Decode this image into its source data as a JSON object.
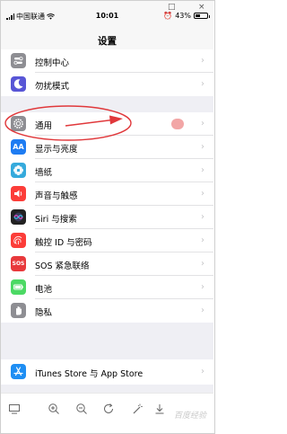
{
  "status": {
    "carrier": "中国联通",
    "time": "10:01",
    "battery": "43%",
    "battery_level": 0.43
  },
  "window_controls": [
    "□",
    "×"
  ],
  "nav": {
    "title": "设置"
  },
  "groups": [
    {
      "items": [
        {
          "label": "控制中心",
          "icon": "control-center-icon",
          "color": "#8e8e93"
        },
        {
          "label": "勿扰模式",
          "icon": "moon-icon",
          "color": "#5856d6"
        }
      ]
    },
    {
      "items": [
        {
          "label": "通用",
          "icon": "gear-icon",
          "color": "#8e8e93"
        },
        {
          "label": "显示与亮度",
          "icon": "display-aa-icon",
          "color": "#1e7cf2"
        },
        {
          "label": "墙纸",
          "icon": "wallpaper-icon",
          "color": "#35aadc"
        },
        {
          "label": "声音与触感",
          "icon": "sound-icon",
          "color": "#fc3d39"
        },
        {
          "label": "Siri 与搜索",
          "icon": "siri-icon",
          "color": "#222222"
        },
        {
          "label": "触控 ID 与密码",
          "icon": "fingerprint-icon",
          "color": "#fc3d39"
        },
        {
          "label": "SOS 紧急联络",
          "icon": "sos-icon",
          "color": "#e8393c"
        },
        {
          "label": "电池",
          "icon": "battery-icon",
          "color": "#4cd964"
        },
        {
          "label": "隐私",
          "icon": "hand-icon",
          "color": "#8e8e93"
        }
      ]
    },
    {
      "items": [
        {
          "label": "iTunes Store 与 App Store",
          "icon": "app-store-icon",
          "color": "#1e8ef3"
        }
      ]
    }
  ],
  "annotation": {
    "highlight_color": "#e0383b"
  },
  "toolbar": {
    "tools": [
      "display-icon",
      "zoom-in-icon",
      "zoom-out-icon",
      "refresh-icon",
      "magic-wand-icon",
      "download-icon"
    ]
  },
  "watermark": "百度经验"
}
